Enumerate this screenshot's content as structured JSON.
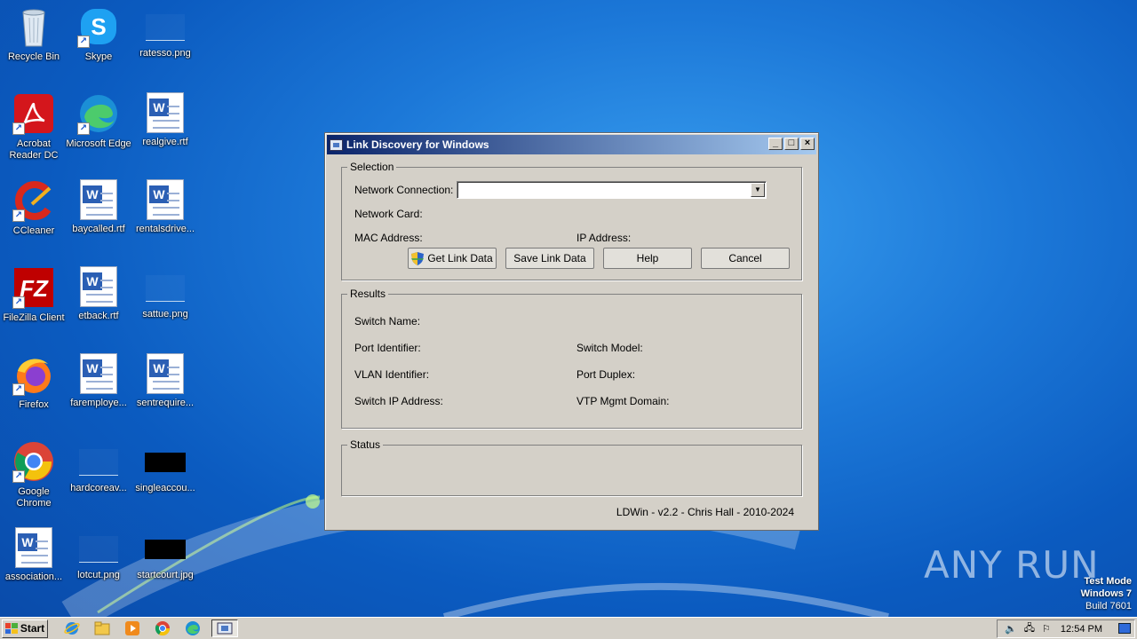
{
  "desktop": {
    "icons": [
      {
        "label": "Recycle Bin"
      },
      {
        "label": "Skype"
      },
      {
        "label": "ratesso.png"
      },
      {
        "label": "Acrobat Reader DC"
      },
      {
        "label": "Microsoft Edge"
      },
      {
        "label": "realgive.rtf"
      },
      {
        "label": "CCleaner"
      },
      {
        "label": "baycalled.rtf"
      },
      {
        "label": "rentalsdrive..."
      },
      {
        "label": "FileZilla Client"
      },
      {
        "label": "etback.rtf"
      },
      {
        "label": "sattue.png"
      },
      {
        "label": "Firefox"
      },
      {
        "label": "faremploye..."
      },
      {
        "label": "sentrequire..."
      },
      {
        "label": "Google Chrome"
      },
      {
        "label": "hardcoreav..."
      },
      {
        "label": "singleaccou..."
      },
      {
        "label": "association..."
      },
      {
        "label": "lotcut.png"
      },
      {
        "label": "startcourt.jpg"
      }
    ]
  },
  "window": {
    "title": "Link Discovery for Windows",
    "selection": {
      "group_label": "Selection",
      "network_connection_label": "Network Connection:",
      "network_connection_value": "",
      "network_card_label": "Network Card:",
      "mac_label": "MAC Address:",
      "ip_label": "IP Address:"
    },
    "buttons": {
      "get": "Get Link Data",
      "save": "Save Link Data",
      "help": "Help",
      "cancel": "Cancel"
    },
    "results": {
      "group_label": "Results",
      "switch_name": "Switch Name:",
      "port_identifier": "Port Identifier:",
      "switch_model": "Switch Model:",
      "vlan_identifier": "VLAN Identifier:",
      "port_duplex": "Port Duplex:",
      "switch_ip": "Switch IP Address:",
      "vtp_domain": "VTP Mgmt Domain:"
    },
    "status": {
      "group_label": "Status"
    },
    "footer": "LDWin - v2.2 - Chris Hall - 2010-2024"
  },
  "taskbar": {
    "start_label": "Start",
    "clock": "12:54 PM"
  },
  "watermark": {
    "brand": "ANY RUN",
    "test_mode": "Test Mode",
    "os": "Windows 7",
    "build": "Build 7601"
  }
}
